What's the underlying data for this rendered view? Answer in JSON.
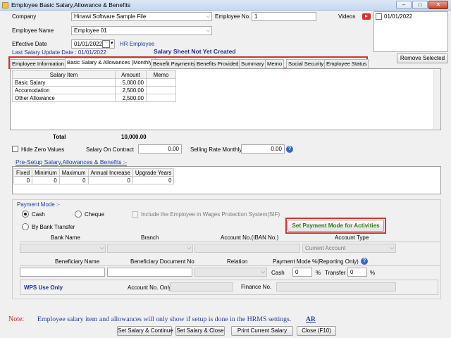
{
  "window": {
    "title": "Employee Basic Salary,Allowance & Benefits",
    "min": "–",
    "max": "□",
    "close": "✕"
  },
  "form": {
    "company_label": "Company",
    "company_value": "Hinawi Software Sample File",
    "employee_no_label": "Employee No.",
    "employee_no_value": "1",
    "videos_label": "Videos",
    "video_date": "01/01/2022",
    "employee_name_label": "Employee Name",
    "employee_name_value": "Employee 01",
    "effective_date_label": "Effective Date",
    "effective_date_value": "01/01/2022",
    "hr_employee": "HR Employee",
    "last_update_label": "Last Salary Update Date : 01/01/2022",
    "sheet_status": "Salary Sheet Not Yet Created",
    "remove_selected": "Remove Selected"
  },
  "tabs": [
    "Employee Information",
    "Basic Salary & Allowances (Monthly)",
    "Benefit Payments",
    "Benefits Provided",
    "Summary",
    "Memo",
    "Social Security",
    "Employee Status"
  ],
  "salary_table": {
    "headers": [
      "Salary Item",
      "Amount",
      "Memo"
    ],
    "rows": [
      {
        "item": "Basic Salary",
        "amount": "5,000.00",
        "memo": ""
      },
      {
        "item": "Accomodation",
        "amount": "2,500.00",
        "memo": ""
      },
      {
        "item": "Other Allowance",
        "amount": "2,500.00",
        "memo": ""
      }
    ],
    "total_label": "Total",
    "total_value": "10,000.00"
  },
  "options": {
    "hide_zero": "Hide Zero Values",
    "salary_contract_label": "Salary On Contract",
    "salary_contract_value": "0.00",
    "selling_rate_label": "Selling Rate Monthly",
    "selling_rate_value": "0.00"
  },
  "presetup": {
    "link": "Pre-Setup Salary,Allowances & Benefits :-",
    "headers": [
      "Fixed",
      "Minimum",
      "Maximum",
      "Annual Increase",
      "Upgrade Years"
    ],
    "row": [
      "0",
      "0",
      "0",
      "0",
      "0"
    ]
  },
  "payment": {
    "title": "Payment Mode :-",
    "cash": "Cash",
    "cheque": "Cheque",
    "wps_include": "Include the Employee in Wages Protection System(SIF)",
    "bank_transfer": "By Bank Transfer",
    "set_mode_button": "Set Payment Mode for Activities",
    "bank_headers": [
      "Bank Name",
      "Branch",
      "Account No.(IBAN No.)",
      "Account Type"
    ],
    "account_type_value": "Current Account",
    "beneficiary_headers": [
      "Beneficiary Name",
      "Beneficiary Document No",
      "Relation",
      "Payment Mode %(Reporting Only)"
    ],
    "cash_pct_label": "Cash",
    "cash_pct_value": "0",
    "pct": "%",
    "transfer_label": "Transfer",
    "transfer_value": "0",
    "wps_only": "WPS Use Only",
    "account_only_label": "Account No. Only",
    "finance_no_label": "Finance No."
  },
  "footer": {
    "note_label": "Note:",
    "note_text": "Employee salary item and allowances will only show if setup is done in the HRMS settings.",
    "ar_link": "AR",
    "buttons": [
      "Set Salary & Continue",
      "Set Salary & Close",
      "Print Current Salary",
      "Close  (F10)"
    ]
  },
  "colors": {
    "highlight_frame": "#c9373b",
    "link_blue": "#1f3b99",
    "note_red": "#c0282d",
    "set_mode_green": "#2d7a1d"
  }
}
